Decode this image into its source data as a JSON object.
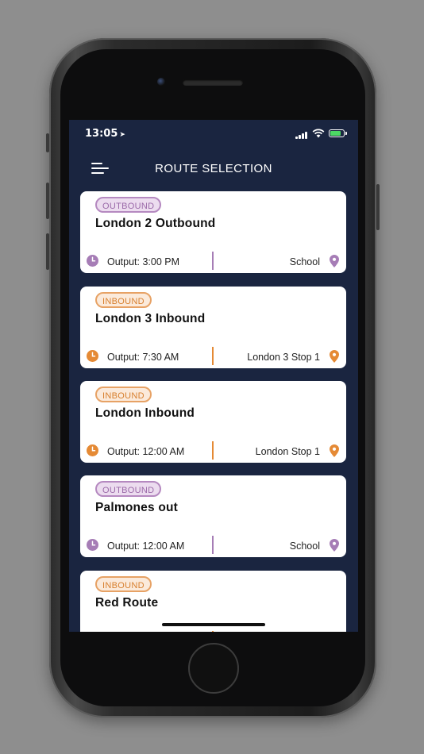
{
  "status_bar": {
    "time": "13:05"
  },
  "nav": {
    "title": "ROUTE SELECTION"
  },
  "colors": {
    "screen_bg": "#1a2540",
    "outbound": "#a67db6",
    "inbound": "#e58a35"
  },
  "routes": [
    {
      "direction": "OUTBOUND",
      "name": "London 2 Outbound",
      "output": "Output: 3:00 PM",
      "stop": "School"
    },
    {
      "direction": "INBOUND",
      "name": "London 3 Inbound",
      "output": "Output: 7:30 AM",
      "stop": "London 3 Stop 1"
    },
    {
      "direction": "INBOUND",
      "name": "London Inbound",
      "output": "Output: 12:00 AM",
      "stop": "London Stop 1"
    },
    {
      "direction": "OUTBOUND",
      "name": "Palmones out",
      "output": "Output: 12:00 AM",
      "stop": "School"
    },
    {
      "direction": "INBOUND",
      "name": "Red Route"
    }
  ]
}
